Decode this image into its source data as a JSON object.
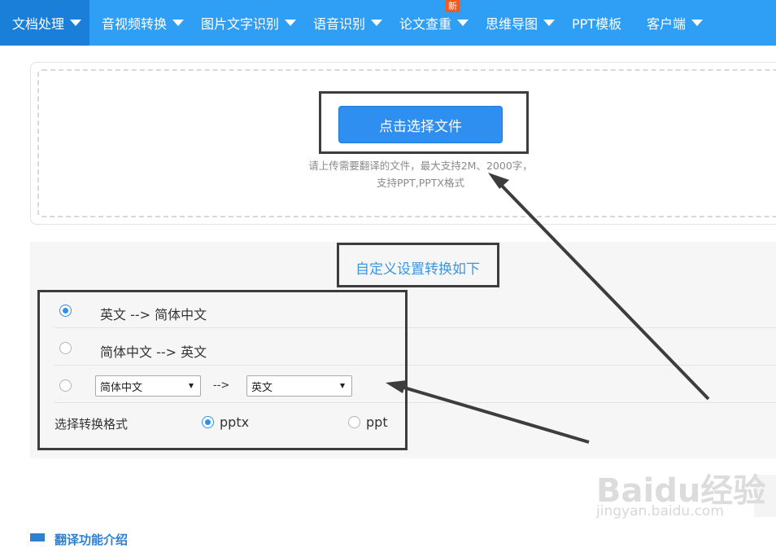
{
  "nav": {
    "items": [
      {
        "label": "文档处理",
        "has_dropdown": true,
        "active": true
      },
      {
        "label": "音视频转换",
        "has_dropdown": true
      },
      {
        "label": "图片文字识别",
        "has_dropdown": true
      },
      {
        "label": "语音识别",
        "has_dropdown": true
      },
      {
        "label": "论文查重",
        "has_dropdown": true,
        "badge": "新"
      },
      {
        "label": "思维导图",
        "has_dropdown": true
      },
      {
        "label": "PPT模板",
        "has_dropdown": false
      },
      {
        "label": "客户端",
        "has_dropdown": true
      }
    ]
  },
  "upload": {
    "button_label": "点击选择文件",
    "hint_line1": "请上传需要翻译的文件，最大支持2M、2000字，",
    "hint_line2": "支持PPT,PPTX格式"
  },
  "settings": {
    "title": "自定义设置转换如下",
    "options": [
      {
        "label": "英文 --> 简体中文",
        "selected": true
      },
      {
        "label": "简体中文 --> 英文",
        "selected": false
      }
    ],
    "custom": {
      "from_value": "简体中文",
      "arrow": "-->",
      "to_value": "英文"
    },
    "format": {
      "label": "选择转换格式",
      "options": [
        {
          "label": "pptx",
          "selected": true
        },
        {
          "label": "ppt",
          "selected": false
        }
      ]
    }
  },
  "watermark": {
    "logo": "Baidu经验",
    "url": "jingyan.baidu.com"
  },
  "footer": {
    "section_title": "翻译功能介绍"
  },
  "colors": {
    "nav_bg": "#2f9ef5",
    "nav_active": "#1a7fd8",
    "accent": "#2f8ff0",
    "badge": "#ef5b1e",
    "annotation": "#3d3d3d"
  }
}
